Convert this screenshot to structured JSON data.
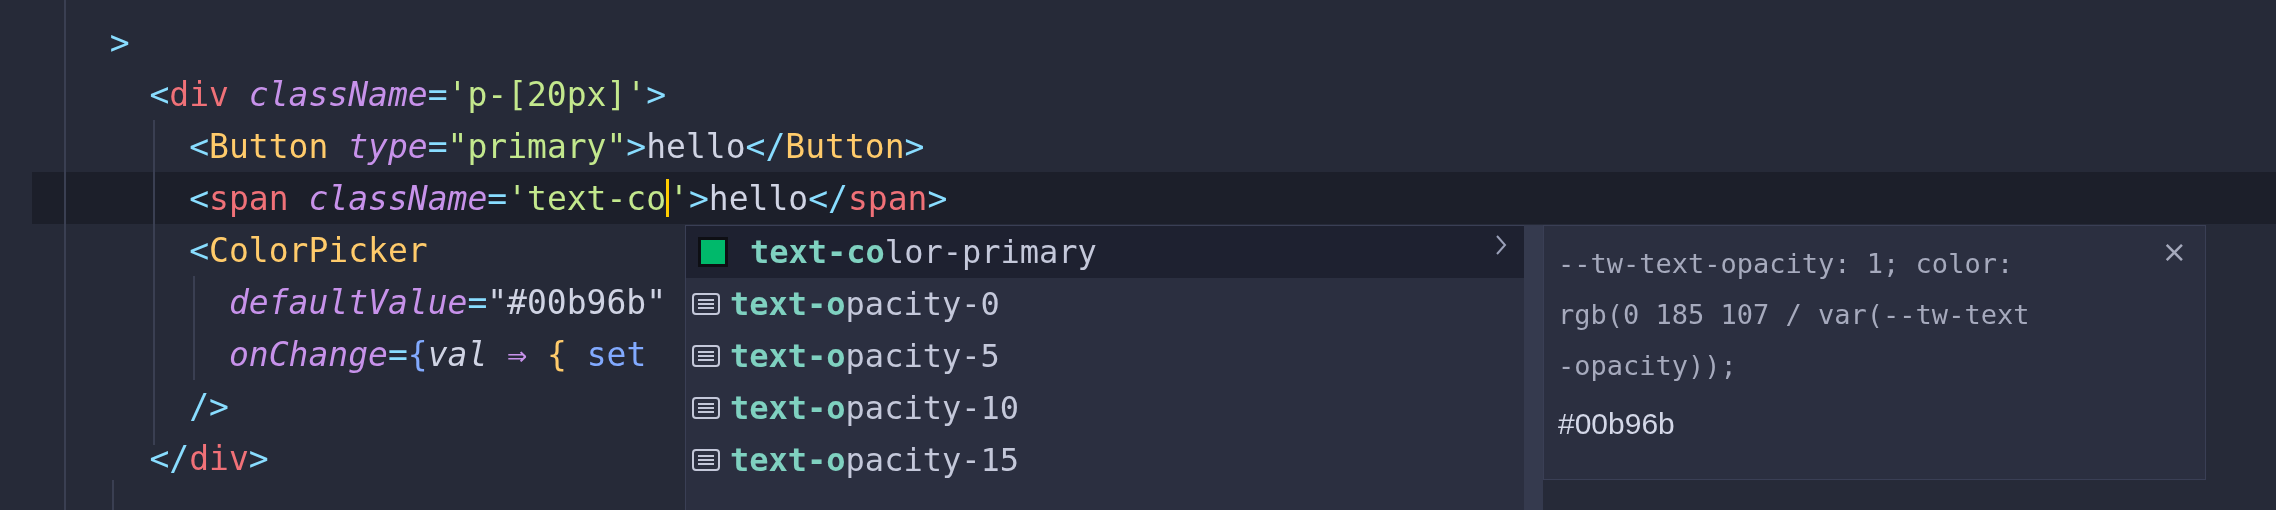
{
  "editor": {
    "lines": [
      {
        "current": false,
        "tokens": [
          {
            "kind": "punct",
            "text": "  >"
          }
        ]
      },
      {
        "current": false,
        "tokens": [
          {
            "kind": "punct",
            "text": "    <"
          },
          {
            "kind": "tag",
            "text": "div"
          },
          {
            "kind": "attr",
            "text": " className"
          },
          {
            "kind": "punct",
            "text": "="
          },
          {
            "kind": "string",
            "text": "'p-[20px]'"
          },
          {
            "kind": "punct",
            "text": ">"
          }
        ]
      },
      {
        "current": false,
        "tokens": [
          {
            "kind": "punct",
            "text": "      <"
          },
          {
            "kind": "component",
            "text": "Button"
          },
          {
            "kind": "attr",
            "text": " type"
          },
          {
            "kind": "punct",
            "text": "="
          },
          {
            "kind": "string",
            "text": "\"primary\""
          },
          {
            "kind": "punct",
            "text": ">"
          },
          {
            "kind": "text",
            "text": "hello"
          },
          {
            "kind": "punct",
            "text": "</"
          },
          {
            "kind": "component",
            "text": "Button"
          },
          {
            "kind": "punct",
            "text": ">"
          }
        ]
      },
      {
        "current": true,
        "tokens": [
          {
            "kind": "punct",
            "text": "      <"
          },
          {
            "kind": "tag",
            "text": "span"
          },
          {
            "kind": "attr",
            "text": " className"
          },
          {
            "kind": "punct",
            "text": "="
          },
          {
            "kind": "string",
            "text": "'text-co"
          },
          {
            "kind": "string",
            "text": "'",
            "caret_before": true
          },
          {
            "kind": "punct",
            "text": ">"
          },
          {
            "kind": "text",
            "text": "hello"
          },
          {
            "kind": "punct",
            "text": "</"
          },
          {
            "kind": "tag",
            "text": "span"
          },
          {
            "kind": "punct",
            "text": ">"
          }
        ]
      },
      {
        "current": false,
        "tokens": [
          {
            "kind": "punct",
            "text": "      <"
          },
          {
            "kind": "component",
            "text": "ColorPicker"
          }
        ]
      },
      {
        "current": false,
        "tokens": [
          {
            "kind": "attr",
            "text": "        defaultValue"
          },
          {
            "kind": "punct",
            "text": "="
          },
          {
            "kind": "text",
            "text": "\"#00b96b\""
          }
        ]
      },
      {
        "current": false,
        "tokens": [
          {
            "kind": "attr",
            "text": "        onChange"
          },
          {
            "kind": "punct",
            "text": "="
          },
          {
            "kind": "func",
            "text": "{"
          },
          {
            "kind": "param",
            "text": "val"
          },
          {
            "kind": "operator",
            "text": " ⇒"
          },
          {
            "kind": "brace",
            "text": " {"
          },
          {
            "kind": "func",
            "text": " set"
          }
        ]
      },
      {
        "current": false,
        "tokens": [
          {
            "kind": "punct",
            "text": "      />"
          }
        ]
      },
      {
        "current": false,
        "tokens": [
          {
            "kind": "punct",
            "text": "    </"
          },
          {
            "kind": "tag",
            "text": "div"
          },
          {
            "kind": "punct",
            "text": ">"
          }
        ]
      }
    ]
  },
  "suggestions": {
    "items": [
      {
        "kind": "color",
        "color": "#00b96b",
        "match": "text-co",
        "rest": "lor-primary",
        "selected": true
      },
      {
        "kind": "value",
        "match": "text-o",
        "rest": "pacity-0",
        "selected": false
      },
      {
        "kind": "value",
        "match": "text-o",
        "rest": "pacity-5",
        "selected": false
      },
      {
        "kind": "value",
        "match": "text-o",
        "rest": "pacity-10",
        "selected": false
      },
      {
        "kind": "value",
        "match": "text-o",
        "rest": "pacity-15",
        "selected": false
      }
    ],
    "details": {
      "css": "--tw-text-opacity: 1; color: rgb(0 185 107 / var(--tw-text-opacity));",
      "value": "#00b96b",
      "close": "×"
    }
  }
}
